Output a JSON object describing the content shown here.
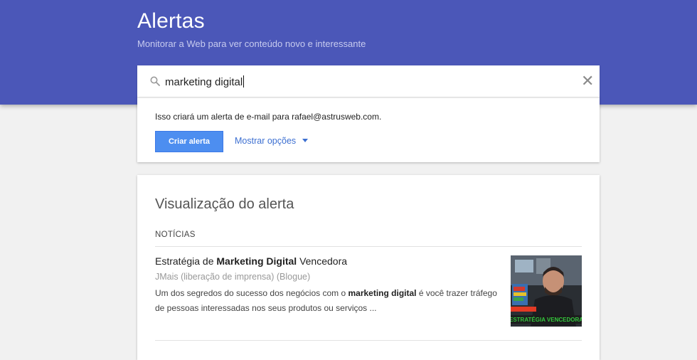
{
  "header": {
    "title": "Alertas",
    "subtitle": "Monitorar a Web para ver conteúdo novo e interessante"
  },
  "search": {
    "value": "marketing digital",
    "icon": "search-icon",
    "clear_icon": "close-icon",
    "clear_glyph": "✕"
  },
  "create_card": {
    "info": "Isso criará um alerta de e-mail para rafael@astrusweb.com.",
    "create_button": "Criar alerta",
    "show_options": "Mostrar opções"
  },
  "preview": {
    "title": "Visualização do alerta",
    "section": "NOTÍCIAS",
    "article": {
      "title_pre": "Estratégia de ",
      "title_bold": "Marketing Digital",
      "title_post": " Vencedora",
      "source": "JMais (liberação de imprensa) (Blogue)",
      "snippet_pre": "Um dos segredos do sucesso dos negócios com o ",
      "snippet_bold": "marketing digital",
      "snippet_post": " é você trazer tráfego de pessoas interessadas nos seus produtos ou serviços ...",
      "thumbnail_text": "ESTRATÉGIA VENCEDORA"
    }
  },
  "colors": {
    "header_bg": "#4b57b8",
    "button_bg": "#4d8ef0",
    "link": "#3c6fd1",
    "page_bg": "#f1f1f1"
  }
}
